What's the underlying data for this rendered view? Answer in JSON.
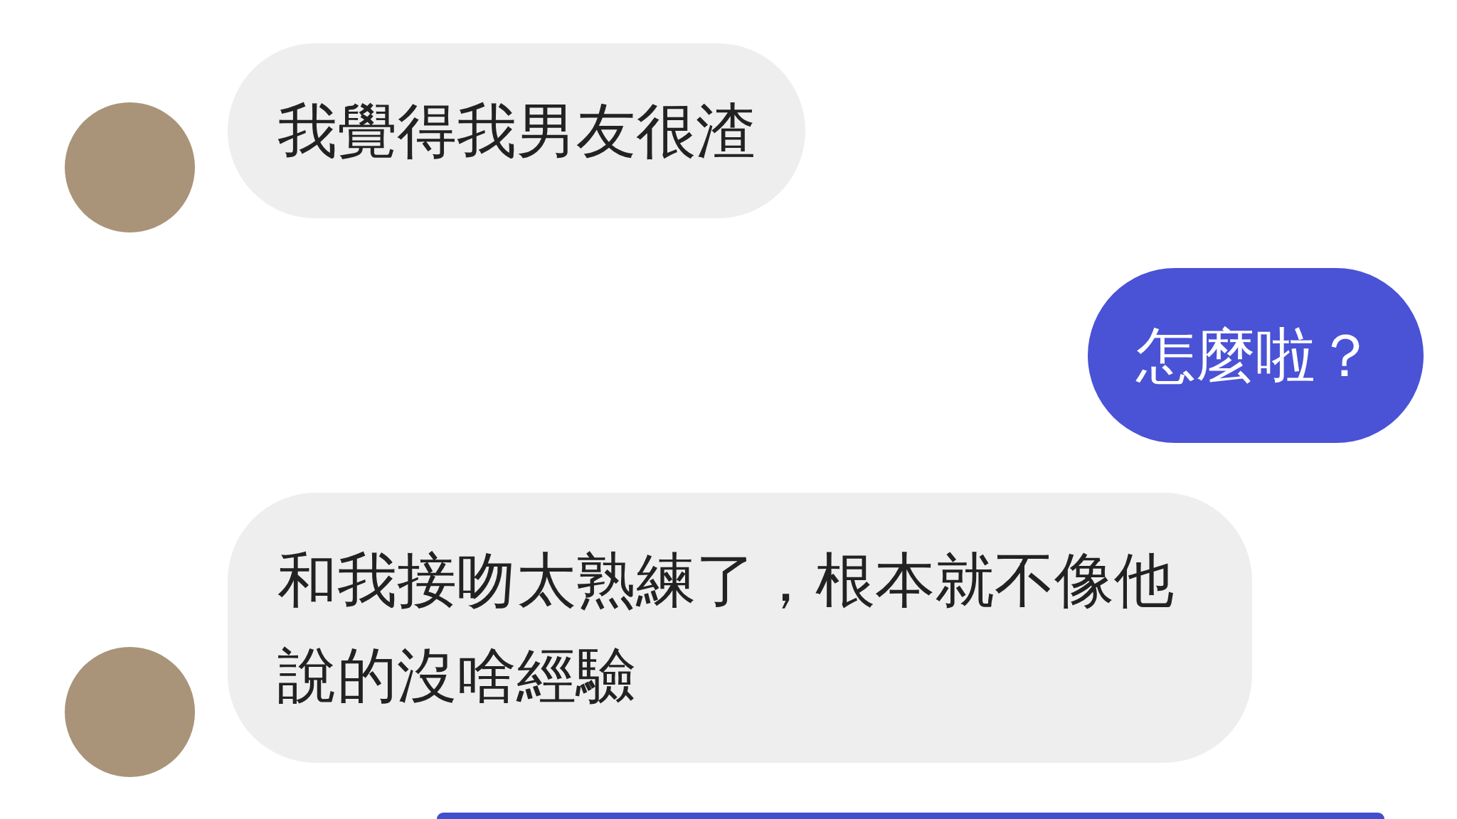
{
  "messages": [
    {
      "outgoing": false,
      "kind": "text",
      "text": "我覺得我男友很渣"
    },
    {
      "outgoing": true,
      "kind": "text",
      "text": "怎麼啦？"
    },
    {
      "outgoing": false,
      "kind": "text",
      "text": "和我接吻太熟練了，根本就不像他說的沒啥經驗"
    },
    {
      "outgoing": true,
      "kind": "cut-off"
    }
  ]
}
